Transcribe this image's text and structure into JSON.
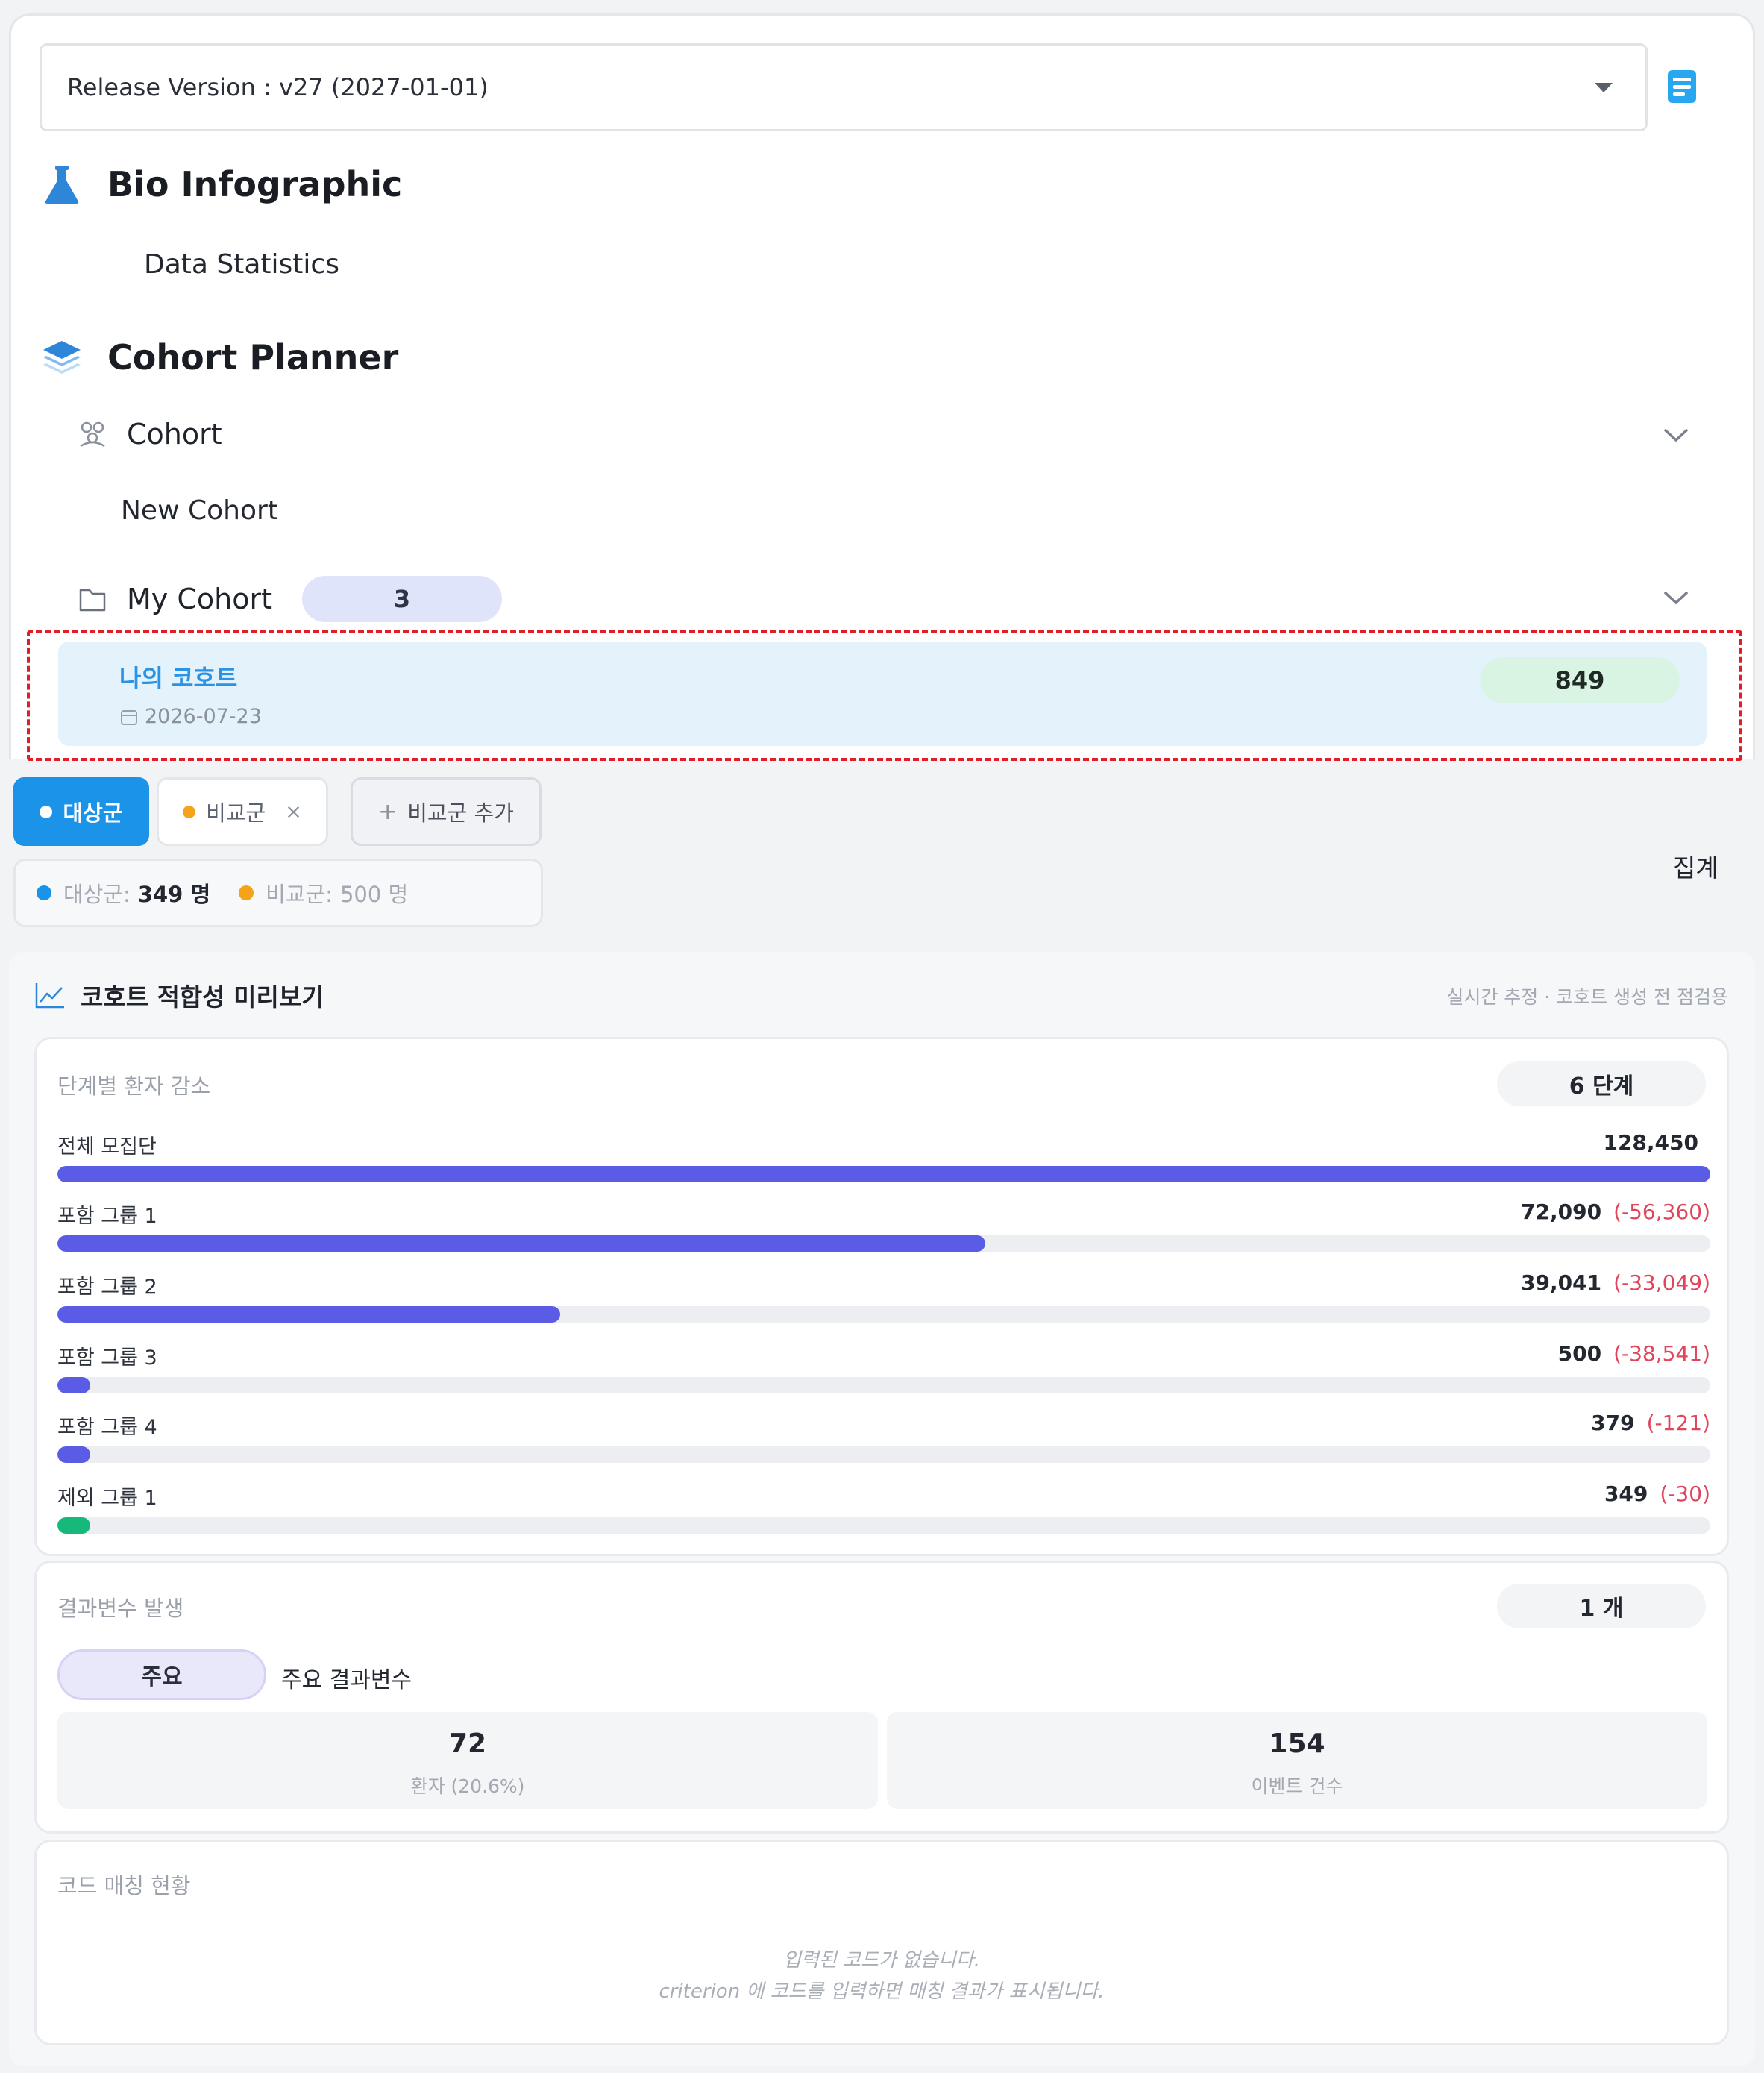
{
  "release": {
    "label": "Release Version : v27 (2027-01-01)"
  },
  "nav": {
    "bio_title": "Bio Infographic",
    "data_statistics": "Data Statistics",
    "planner_title": "Cohort Planner",
    "cohort": "Cohort",
    "new_cohort": "New Cohort",
    "my_cohort": "My Cohort",
    "my_cohort_count": "3",
    "cohort_item": {
      "name": "나의 코호트",
      "date": "2026-07-23",
      "count": "849"
    }
  },
  "groups": {
    "target_tab": "대상군",
    "compare_tab": "비교군",
    "close_glyph": "×",
    "add_tab": "비교군 추가",
    "add_glyph": "+",
    "summary": {
      "target_label": "대상군:",
      "target_value": "349 명",
      "compare_label": "비교군:",
      "compare_value": "500 명"
    },
    "aggregate": "집계"
  },
  "preview": {
    "title": "코호트 적합성 미리보기",
    "note": "실시간 추정 · 코호트 생성 전 점검용",
    "attrition": {
      "title": "단계별 환자 감소",
      "badge": "6 단계",
      "steps": [
        {
          "label": "전체 모집단",
          "count": "128,450",
          "delta": "",
          "value": 128450,
          "color": "#5b5ce6"
        },
        {
          "label": "포함 그룹 1",
          "count": "72,090",
          "delta": "(-56,360)",
          "value": 72090,
          "color": "#5b5ce6"
        },
        {
          "label": "포함 그룹 2",
          "count": "39,041",
          "delta": "(-33,049)",
          "value": 39041,
          "color": "#5b5ce6"
        },
        {
          "label": "포함 그룹 3",
          "count": "500",
          "delta": "(-38,541)",
          "value": 500,
          "color": "#5b5ce6"
        },
        {
          "label": "포함 그룹 4",
          "count": "379",
          "delta": "(-121)",
          "value": 379,
          "color": "#5b5ce6"
        },
        {
          "label": "제외 그룹 1",
          "count": "349",
          "delta": "(-30)",
          "value": 349,
          "color": "#17b97a"
        }
      ]
    },
    "outcome": {
      "title": "결과변수 발생",
      "badge": "1 개",
      "primary_pill": "주요",
      "primary_label": "주요 결과변수",
      "patients_value": "72",
      "patients_label": "환자 (20.6%)",
      "events_value": "154",
      "events_label": "이벤트 건수"
    },
    "codes": {
      "title": "코드 매칭 현황",
      "empty_line1": "입력된 코드가 없습니다.",
      "empty_line2": "criterion 에 코드를 입력하면 매칭 결과가 표시됩니다."
    }
  },
  "colors": {
    "primary": "#1a93e8",
    "target_dot": "#1a93e8",
    "compare_dot": "#f5a31a",
    "delta": "#e0455c"
  }
}
